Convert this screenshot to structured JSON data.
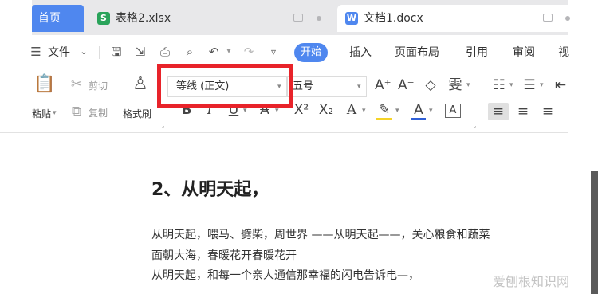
{
  "tabs": {
    "home": "首页",
    "xlsx": "表格2.xlsx",
    "xlsx_icon": "S",
    "docx": "文档1.docx",
    "docx_icon": "W"
  },
  "menu": {
    "file": "文件",
    "start": "开始",
    "insert": "插入",
    "layout": "页面布局",
    "references": "引用",
    "review": "审阅",
    "view_partial": "视"
  },
  "ribbon": {
    "cut": "剪切",
    "paste_partial": "粘贴",
    "copy": "复制",
    "format_painter": "格式刷",
    "font_name": "等线 (正文)",
    "font_size": "五号",
    "bold": "B",
    "italic": "I",
    "underline": "U",
    "strikethrough": "A",
    "superscript": "X²",
    "subscript": "X₂",
    "font_effect": "A",
    "font_color": "A",
    "char_border": "A"
  },
  "document": {
    "heading": "2、从明天起，",
    "line1": "从明天起，喂马、劈柴，周世界 ——从明天起——，关心粮食和蔬菜",
    "line2": "面朝大海，春暖花开春暖花开",
    "line3": "从明天起，和每一个亲人通信那幸福的闪电告诉电—，"
  },
  "watermark": "爱刨根知识网",
  "colors": {
    "accent_blue": "#4f87ef",
    "excel_green": "#29a35a",
    "highlight_red": "#e8232a",
    "highlighter_yellow": "#f5d327",
    "font_color_blue": "#2f5fd6"
  }
}
